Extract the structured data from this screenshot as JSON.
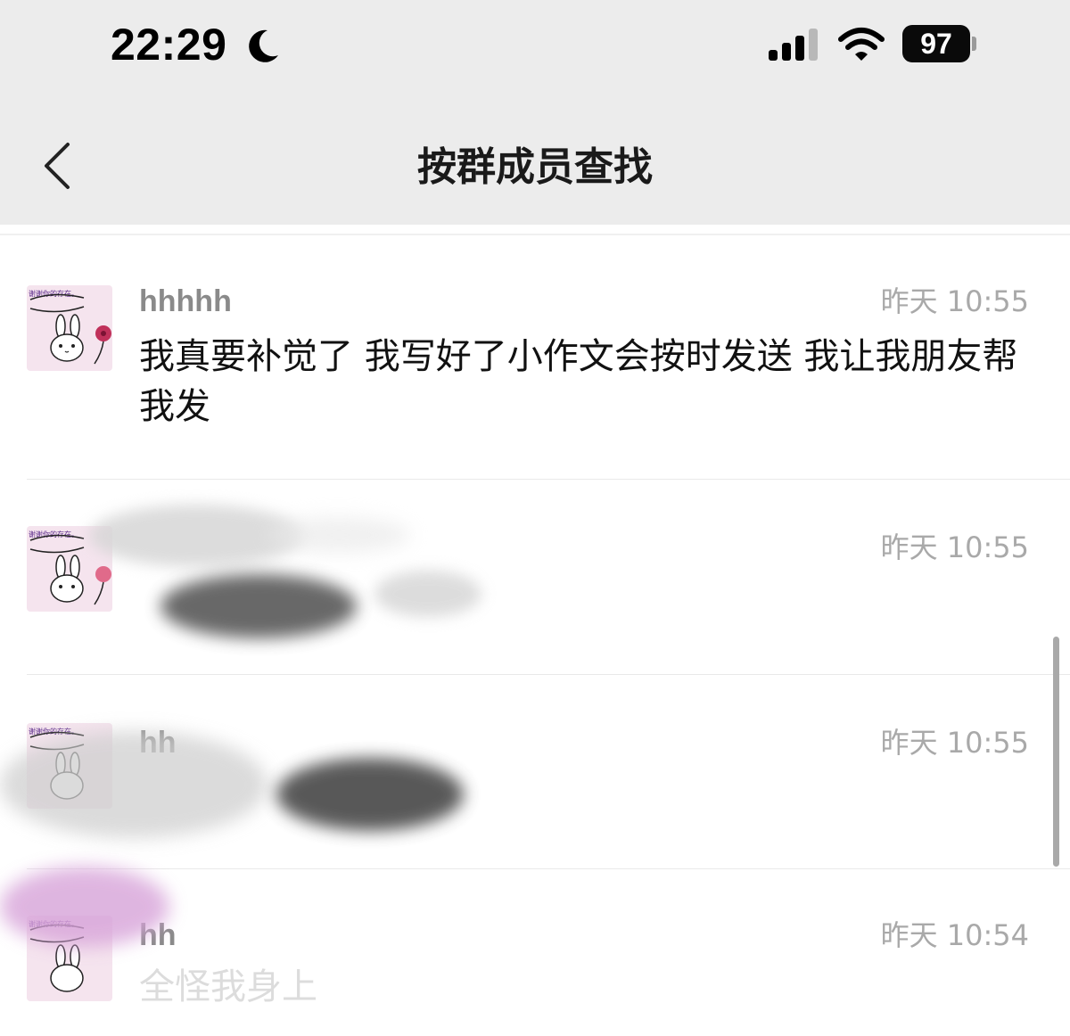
{
  "status_bar": {
    "time": "22:29",
    "battery": "97",
    "icons": [
      "moon-icon",
      "cellular-signal-icon",
      "wifi-icon",
      "battery-icon"
    ]
  },
  "nav": {
    "title": "按群成员查找",
    "back_icon": "chevron-left-icon"
  },
  "avatar_caption": "谢谢你的存在。",
  "messages": [
    {
      "sender": "hhhhh",
      "time": "昨天 10:55",
      "content": "我真要补觉了 我写好了小作文会按时发送 我让我朋友帮我发"
    },
    {
      "sender": "",
      "time": "昨天 10:55",
      "content": ""
    },
    {
      "sender": "hh",
      "time": "昨天 10:55",
      "content": ""
    },
    {
      "sender": "hh",
      "time": "昨天 10:54",
      "content": "全怪我身上"
    }
  ],
  "colors": {
    "header_bg": "#ececec",
    "text": "#111111",
    "secondary": "#a9a9a9",
    "avatar_bg": "#f5e4ee",
    "flower": "#c0305a"
  }
}
